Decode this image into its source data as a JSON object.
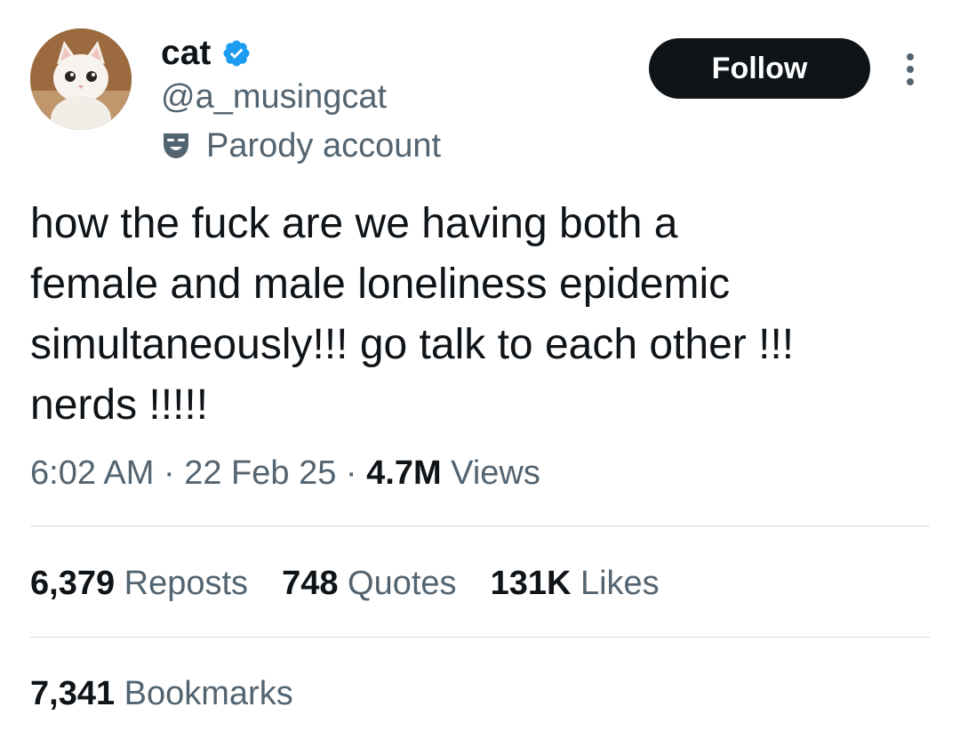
{
  "tweet": {
    "author": {
      "display_name": "cat",
      "handle": "@a_musingcat",
      "verified_icon": "verified-badge-icon",
      "label_icon": "parody-mask-icon",
      "label": "Parody account"
    },
    "follow_label": "Follow",
    "more_icon": "more-vertical-icon",
    "text": "how the fuck are we having both a\nfemale and male loneliness epidemic\nsimultaneously!!! go talk to each other !!!\nnerds !!!!!",
    "time": "6:02 AM",
    "separator": "·",
    "date": "22 Feb 25",
    "views_count": "4.7M",
    "views_label": "Views"
  },
  "stats": {
    "reposts_count": "6,379",
    "reposts_label": "Reposts",
    "quotes_count": "748",
    "quotes_label": "Quotes",
    "likes_count": "131K",
    "likes_label": "Likes",
    "bookmarks_count": "7,341",
    "bookmarks_label": "Bookmarks"
  },
  "colors": {
    "text_primary": "#0f1419",
    "text_secondary": "#536471",
    "verified_blue": "#1d9bf0",
    "follow_bg": "#0f1419",
    "divider": "#d7dbdc"
  }
}
